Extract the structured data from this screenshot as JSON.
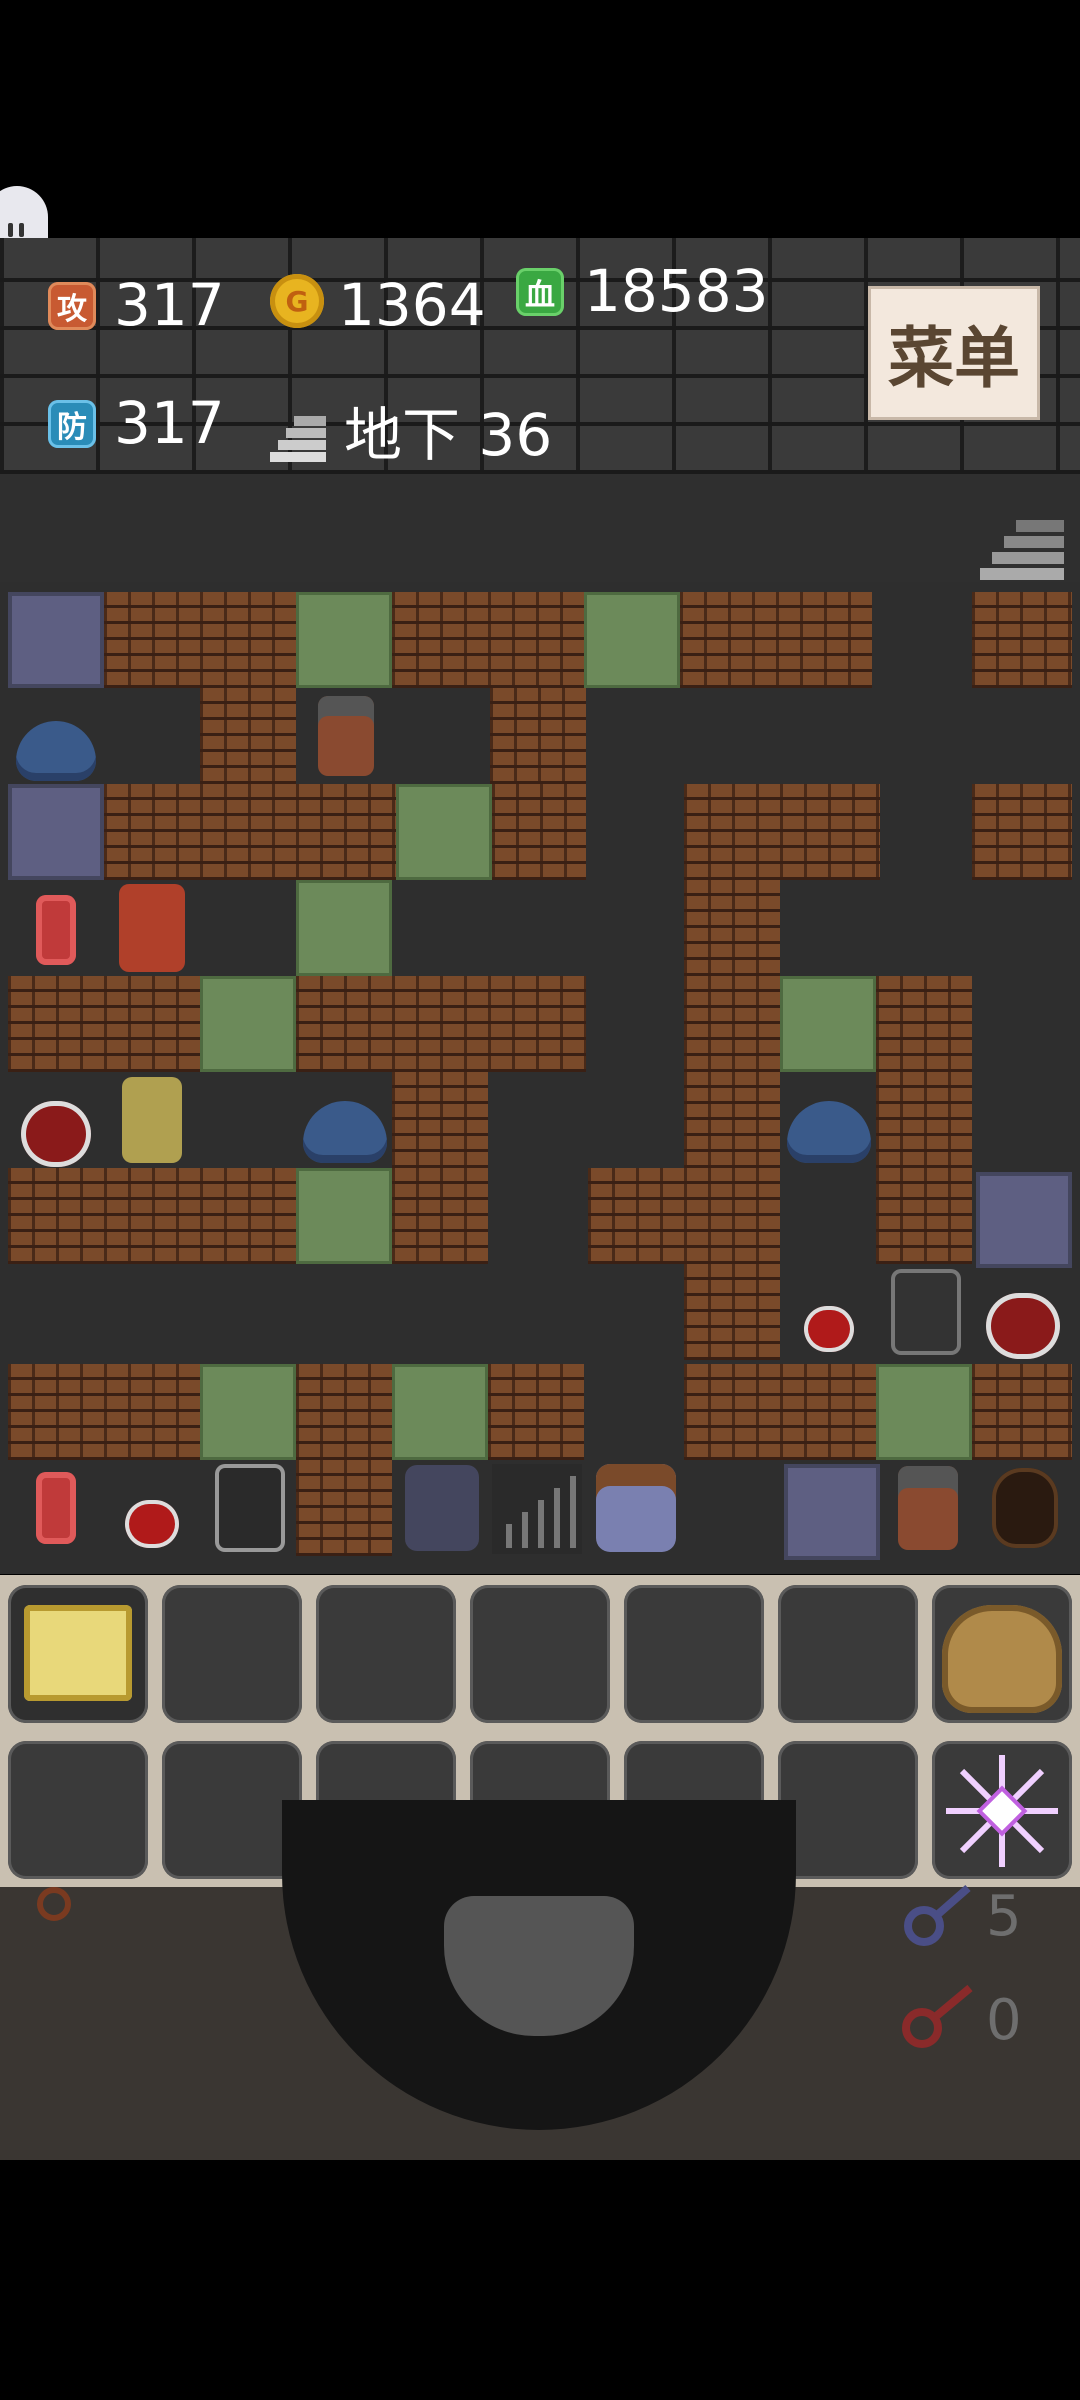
{
  "header": {
    "attack": {
      "icon_text": "攻",
      "value": "317"
    },
    "gold": {
      "icon_text": "G",
      "value": "1364"
    },
    "hp": {
      "icon_text": "血",
      "value": "18583"
    },
    "defense": {
      "icon_text": "防",
      "value": "317"
    },
    "floor": {
      "label": "地下 36"
    },
    "menu_label": "菜单"
  },
  "keys": {
    "blue_count": "5",
    "red_count": "0"
  },
  "colors": {
    "attack_icon": "#c85a32",
    "gold_icon": "#e8b420",
    "hp_icon": "#3aa842",
    "defense_icon": "#2a8cb8"
  },
  "icons": [
    "pause-icon",
    "attack-icon",
    "gold-coin-icon",
    "hp-icon",
    "defense-icon",
    "stairs-icon",
    "monster-manual-icon",
    "potion-jar-icon",
    "snowflake-icon",
    "blue-key-icon",
    "red-key-icon"
  ]
}
